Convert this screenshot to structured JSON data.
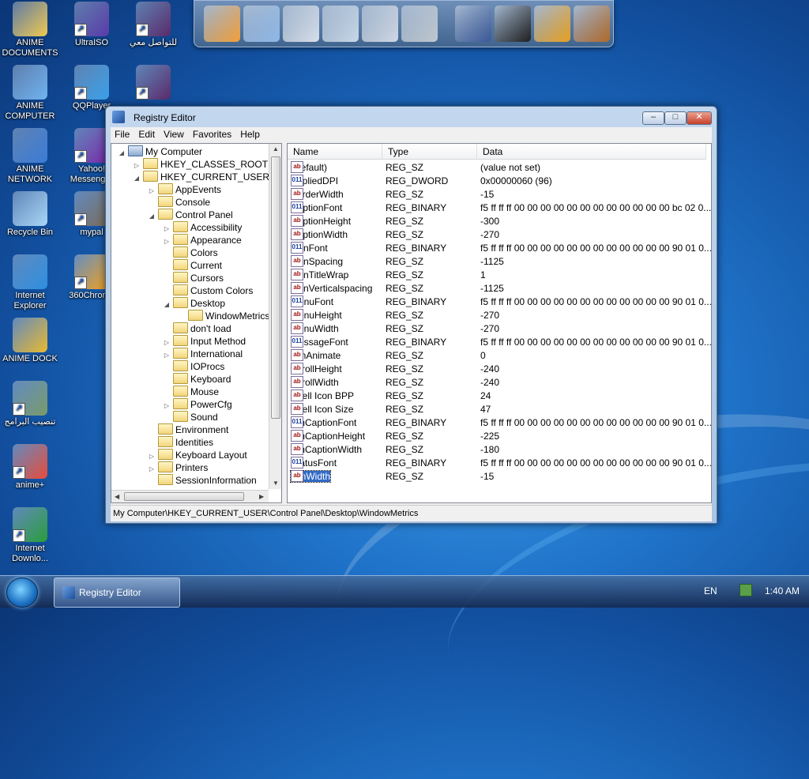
{
  "desktop": {
    "icons": [
      {
        "label": "ANIME DOCUMENTS",
        "color": "#f0c850"
      },
      {
        "label": "ANIME COMPUTER",
        "color": "#6fb2ef"
      },
      {
        "label": "ANIME NETWORK",
        "color": "#3a7bd5"
      },
      {
        "label": "Recycle Bin",
        "color": "#a9d6f5"
      },
      {
        "label": "Internet Explorer",
        "color": "#2d8fe0"
      },
      {
        "label": "ANIME DOCK",
        "color": "#e8b830"
      },
      {
        "label": "تنصيب البرامج",
        "color": "#7a9a6a"
      },
      {
        "label": "anime+",
        "color": "#e84b3a"
      },
      {
        "label": "Internet Downlo...",
        "color": "#2a9d3a"
      },
      {
        "label": "UltraISO",
        "color": "#5a3aa8"
      },
      {
        "label": "QQPlayer",
        "color": "#3aa0e8"
      },
      {
        "label": "Yahoo! Messenger",
        "color": "#7a2aa8"
      },
      {
        "label": "mypal",
        "color": "#7a6a5a"
      },
      {
        "label": "360Chrome",
        "color": "#f0a020"
      },
      {
        "label": "للتواصل معي",
        "color": "#5a2a6a"
      },
      {
        "label": "",
        "color": "#5a2a6a"
      }
    ]
  },
  "dock": {
    "items": [
      "naruto-icon",
      "globe-icon",
      "folder-doc-icon",
      "folder-music-icon",
      "folder-pictures-icon",
      "tools-icon",
      "facebook-icon",
      "tshirt-icon",
      "hammer-icon",
      "bucket-icon"
    ]
  },
  "window": {
    "title": "Registry Editor",
    "controls": {
      "minimize": "–",
      "maximize": "□",
      "close": "✕"
    },
    "menu": [
      "File",
      "Edit",
      "View",
      "Favorites",
      "Help"
    ],
    "tree": [
      {
        "label": "My Computer",
        "depth": 0,
        "exp": "◢",
        "kind": "computer"
      },
      {
        "label": "HKEY_CLASSES_ROOT",
        "depth": 1,
        "exp": "▷"
      },
      {
        "label": "HKEY_CURRENT_USER",
        "depth": 1,
        "exp": "◢"
      },
      {
        "label": "AppEvents",
        "depth": 2,
        "exp": "▷"
      },
      {
        "label": "Console",
        "depth": 2,
        "exp": ""
      },
      {
        "label": "Control Panel",
        "depth": 2,
        "exp": "◢"
      },
      {
        "label": "Accessibility",
        "depth": 3,
        "exp": "▷"
      },
      {
        "label": "Appearance",
        "depth": 3,
        "exp": "▷"
      },
      {
        "label": "Colors",
        "depth": 3,
        "exp": ""
      },
      {
        "label": "Current",
        "depth": 3,
        "exp": ""
      },
      {
        "label": "Cursors",
        "depth": 3,
        "exp": ""
      },
      {
        "label": "Custom Colors",
        "depth": 3,
        "exp": ""
      },
      {
        "label": "Desktop",
        "depth": 3,
        "exp": "◢"
      },
      {
        "label": "WindowMetrics",
        "depth": 4,
        "exp": ""
      },
      {
        "label": "don't load",
        "depth": 3,
        "exp": ""
      },
      {
        "label": "Input Method",
        "depth": 3,
        "exp": "▷"
      },
      {
        "label": "International",
        "depth": 3,
        "exp": "▷"
      },
      {
        "label": "IOProcs",
        "depth": 3,
        "exp": ""
      },
      {
        "label": "Keyboard",
        "depth": 3,
        "exp": ""
      },
      {
        "label": "Mouse",
        "depth": 3,
        "exp": ""
      },
      {
        "label": "PowerCfg",
        "depth": 3,
        "exp": "▷"
      },
      {
        "label": "Sound",
        "depth": 3,
        "exp": ""
      },
      {
        "label": "Environment",
        "depth": 2,
        "exp": ""
      },
      {
        "label": "Identities",
        "depth": 2,
        "exp": ""
      },
      {
        "label": "Keyboard Layout",
        "depth": 2,
        "exp": "▷"
      },
      {
        "label": "Printers",
        "depth": 2,
        "exp": "▷"
      },
      {
        "label": "SessionInformation",
        "depth": 2,
        "exp": ""
      }
    ],
    "columns": [
      "Name",
      "Type",
      "Data"
    ],
    "values": [
      {
        "name": "(Default)",
        "type": "REG_SZ",
        "data": "(value not set)"
      },
      {
        "name": "AppliedDPI",
        "type": "REG_DWORD",
        "data": "0x00000060 (96)"
      },
      {
        "name": "BorderWidth",
        "type": "REG_SZ",
        "data": "-15"
      },
      {
        "name": "CaptionFont",
        "type": "REG_BINARY",
        "data": "f5 ff ff ff 00 00 00 00 00 00 00 00 00 00 00 00 bc 02 0..."
      },
      {
        "name": "CaptionHeight",
        "type": "REG_SZ",
        "data": "-300"
      },
      {
        "name": "CaptionWidth",
        "type": "REG_SZ",
        "data": "-270"
      },
      {
        "name": "IconFont",
        "type": "REG_BINARY",
        "data": "f5 ff ff ff 00 00 00 00 00 00 00 00 00 00 00 00 90 01 0..."
      },
      {
        "name": "IconSpacing",
        "type": "REG_SZ",
        "data": "-1125"
      },
      {
        "name": "IconTitleWrap",
        "type": "REG_SZ",
        "data": "1"
      },
      {
        "name": "IconVerticalspacing",
        "type": "REG_SZ",
        "data": "-1125"
      },
      {
        "name": "MenuFont",
        "type": "REG_BINARY",
        "data": "f5 ff ff ff 00 00 00 00 00 00 00 00 00 00 00 00 90 01 0..."
      },
      {
        "name": "MenuHeight",
        "type": "REG_SZ",
        "data": "-270"
      },
      {
        "name": "MenuWidth",
        "type": "REG_SZ",
        "data": "-270"
      },
      {
        "name": "MessageFont",
        "type": "REG_BINARY",
        "data": "f5 ff ff ff 00 00 00 00 00 00 00 00 00 00 00 00 90 01 0..."
      },
      {
        "name": "MinAnimate",
        "type": "REG_SZ",
        "data": "0"
      },
      {
        "name": "ScrollHeight",
        "type": "REG_SZ",
        "data": "-240"
      },
      {
        "name": "ScrollWidth",
        "type": "REG_SZ",
        "data": "-240"
      },
      {
        "name": "Shell Icon BPP",
        "type": "REG_SZ",
        "data": "24"
      },
      {
        "name": "Shell Icon Size",
        "type": "REG_SZ",
        "data": "47"
      },
      {
        "name": "SmCaptionFont",
        "type": "REG_BINARY",
        "data": "f5 ff ff ff 00 00 00 00 00 00 00 00 00 00 00 00 90 01 0..."
      },
      {
        "name": "SmCaptionHeight",
        "type": "REG_SZ",
        "data": "-225"
      },
      {
        "name": "SmCaptionWidth",
        "type": "REG_SZ",
        "data": "-180"
      },
      {
        "name": "StatusFont",
        "type": "REG_BINARY",
        "data": "f5 ff ff ff 00 00 00 00 00 00 00 00 00 00 00 00 90 01 0..."
      },
      {
        "name": "MinWidth",
        "type": "REG_SZ",
        "data": "-15",
        "selected": true
      }
    ],
    "status_path": "My Computer\\HKEY_CURRENT_USER\\Control Panel\\Desktop\\WindowMetrics"
  },
  "taskbar": {
    "app_label": "Registry Editor",
    "language": "EN",
    "clock": "1:40 AM"
  },
  "colors": {
    "selection": "#316ac5",
    "titlebar": "#a9c3e3"
  }
}
